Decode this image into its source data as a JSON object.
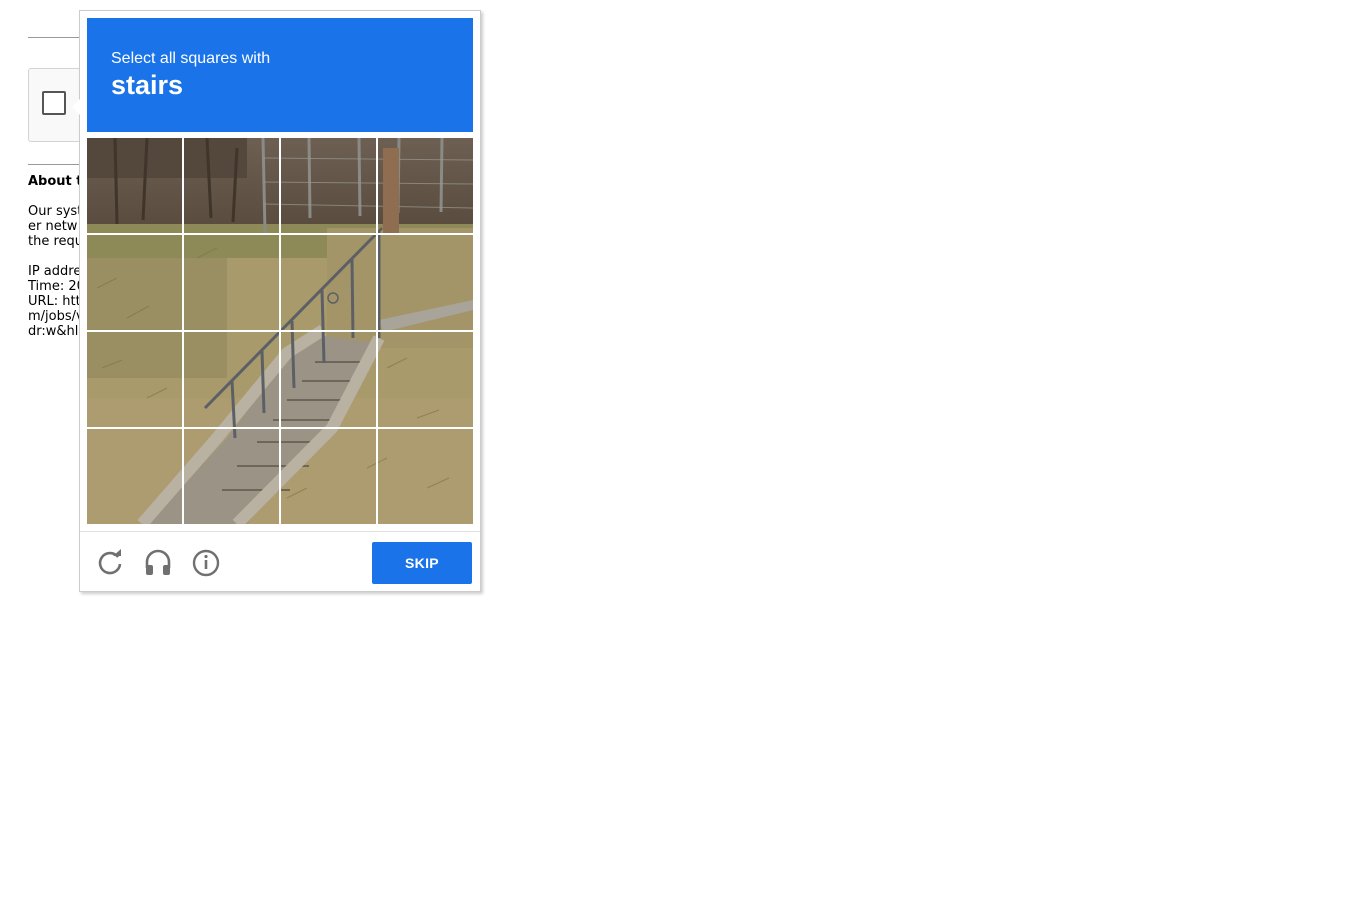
{
  "background_page": {
    "heading_fragment": "About t",
    "paragraph_lines": [
      "Our syst",
      "er netw",
      "the requ"
    ],
    "info_lines": [
      "IP addre",
      "Time: 20",
      "URL: htt",
      "m/jobs/v",
      "dr:w&hl"
    ]
  },
  "challenge": {
    "instruction": "Select all squares with",
    "target": "stairs",
    "grid_rows": 4,
    "grid_cols": 4,
    "skip_label": "SKIP"
  },
  "icons": {
    "reload": "reload-icon",
    "audio": "headphones-icon",
    "info": "info-icon"
  },
  "colors": {
    "accent": "#1a73e8",
    "icon_gray": "#707070"
  }
}
